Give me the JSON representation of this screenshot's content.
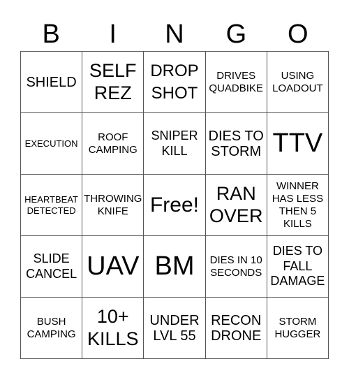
{
  "header": [
    "B",
    "I",
    "N",
    "G",
    "O"
  ],
  "cells": [
    {
      "text": "SHIELD",
      "size": "s20"
    },
    {
      "text": "SELF REZ",
      "size": "s27"
    },
    {
      "text": "DROP SHOT",
      "size": "s24"
    },
    {
      "text": "DRIVES QUADBIKE",
      "size": "s15"
    },
    {
      "text": "USING LOADOUT",
      "size": "s15"
    },
    {
      "text": "EXECUTION",
      "size": "s13"
    },
    {
      "text": "ROOF CAMPING",
      "size": "s15"
    },
    {
      "text": "SNIPER KILL",
      "size": "s18"
    },
    {
      "text": "DIES TO STORM",
      "size": "s20"
    },
    {
      "text": "TTV",
      "size": "s36"
    },
    {
      "text": "HEARTBEAT DETECTED",
      "size": "s13"
    },
    {
      "text": "THROWING KNIFE",
      "size": "s15"
    },
    {
      "text": "Free!",
      "size": "s30"
    },
    {
      "text": "RAN OVER",
      "size": "s27"
    },
    {
      "text": "WINNER HAS LESS THEN 5 KILLS",
      "size": "s15"
    },
    {
      "text": "SLIDE CANCEL",
      "size": "s18"
    },
    {
      "text": "UAV",
      "size": "s36"
    },
    {
      "text": "BM",
      "size": "s36"
    },
    {
      "text": "DIES IN 10 SECONDS",
      "size": "s15"
    },
    {
      "text": "DIES TO FALL DAMAGE",
      "size": "s18"
    },
    {
      "text": "BUSH CAMPING",
      "size": "s15"
    },
    {
      "text": "10+ KILLS",
      "size": "s27"
    },
    {
      "text": "UNDER LVL 55",
      "size": "s20"
    },
    {
      "text": "RECON DRONE",
      "size": "s20"
    },
    {
      "text": "STORM HUGGER",
      "size": "s15"
    }
  ]
}
